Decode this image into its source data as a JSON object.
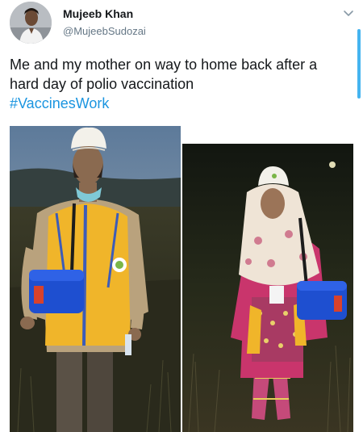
{
  "tweet": {
    "author": {
      "name": "Mujeeb Khan",
      "handle": "@MujeebSudozai",
      "avatar_icon": "user-avatar"
    },
    "text_lines": [
      "Me and my mother on way to home back after a",
      "hard day of polio  vaccination"
    ],
    "hashtag": "#VaccinesWork",
    "menu_icon": "chevron-down-icon",
    "media": [
      {
        "name": "photo-man-vaccinator"
      },
      {
        "name": "photo-mother-vaccinator"
      }
    ]
  },
  "colors": {
    "text": "#14171a",
    "secondary": "#657786",
    "link": "#1b95e0",
    "scroll_accent": "#45b4f0"
  }
}
